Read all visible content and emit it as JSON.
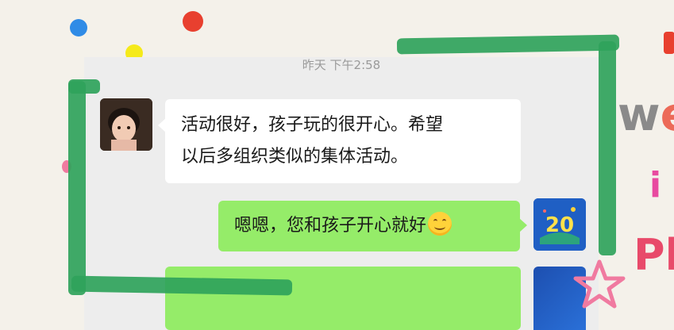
{
  "chat": {
    "timestamp": "昨天 下午2:58",
    "messages": [
      {
        "direction": "incoming",
        "line1": "活动很好，孩子玩的很开心。希望",
        "line2": "以后多组织类似的集体活动。",
        "avatar": "child-photo"
      },
      {
        "direction": "outgoing",
        "text": "嗯嗯，您和孩子开心就好",
        "emoji": "smile-emoji",
        "avatar": "logo-20-badge"
      }
    ],
    "avatar_badge_text": "20"
  },
  "colors": {
    "outgoing_bubble": "#95ec69",
    "incoming_bubble": "#ffffff",
    "chat_background": "#ededed",
    "frame_stroke": "#2fa35b",
    "page_background": "#f4f1ea"
  }
}
